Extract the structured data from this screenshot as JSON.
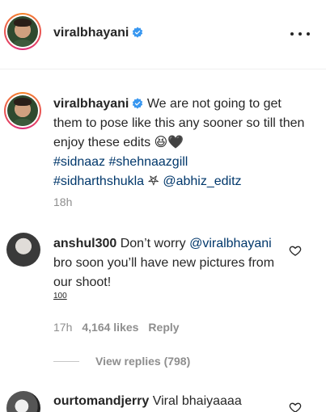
{
  "header": {
    "username": "viralbhayani",
    "more_label": "More options"
  },
  "caption": {
    "username": "viralbhayani",
    "text": "We are not going to get them to pose like this any sooner so till then enjoy these edits 😆🖤",
    "tags": [
      "#sidnaaz",
      "#shehnaazgill",
      "#sidharthshukla",
      "𖤐",
      "@abhiz_editz"
    ],
    "time": "18h"
  },
  "comments": [
    {
      "username": "anshul300",
      "text_prefix": "Don’t worry ",
      "mention": "@viralbhayani",
      "text_suffix": " bro soon you’ll have new pictures from our shoot!",
      "badge": "100",
      "time": "17h",
      "likes": "4,164 likes",
      "reply": "Reply",
      "view_replies": "View replies (798)"
    },
    {
      "username": "ourtomandjerry",
      "text": "Viral bhaiyaaaa"
    }
  ],
  "colors": {
    "link": "#00376b",
    "muted": "#8e8e8e",
    "verified": "#3897f0"
  }
}
